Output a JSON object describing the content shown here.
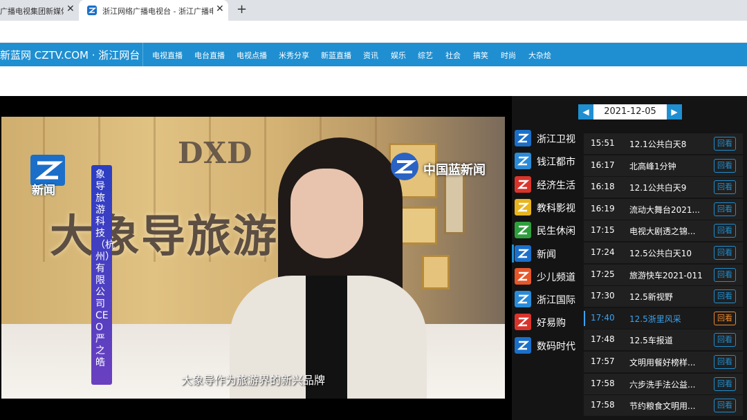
{
  "browser": {
    "tabs": [
      {
        "title": "广播电视集团新媒体",
        "close": "✕"
      },
      {
        "title": "浙江网络广播电视台 - 浙江广播电视",
        "close": "✕"
      }
    ],
    "new_tab": "+"
  },
  "site": {
    "title": "新蓝网 CZTV.COM · 浙江网台",
    "nav": [
      "电视直播",
      "电台直播",
      "电视点播",
      "米秀分享",
      "新蓝直播",
      "资讯",
      "娱乐",
      "综艺",
      "社会",
      "搞笑",
      "时尚",
      "大杂烩"
    ]
  },
  "video": {
    "wall_logo": "DXD",
    "wall_text": "大象导旅游",
    "channel_logo_text": "新闻",
    "corner_logo_text": "中国蓝新闻",
    "lower_third": "象导旅游科技（杭州）有限公司 CEO 严之皓",
    "caption": "大象导作为旅游界的新兴品牌"
  },
  "epg": {
    "date": "2021-12-05",
    "prev_icon": "arrow-left-icon",
    "next_icon": "arrow-right-icon",
    "channels": [
      {
        "name": "浙江卫视",
        "color": "#1b6fc9"
      },
      {
        "name": "钱江都市",
        "color": "#2a8bd8"
      },
      {
        "name": "经济生活",
        "color": "#d9342b"
      },
      {
        "name": "教科影视",
        "color": "#e8b520"
      },
      {
        "name": "民生休闲",
        "color": "#2f9e3d"
      },
      {
        "name": "新闻",
        "color": "#1b6fc9"
      },
      {
        "name": "少儿频道",
        "color": "#e6572a"
      },
      {
        "name": "浙江国际",
        "color": "#2a8bd8"
      },
      {
        "name": "好易购",
        "color": "#d9342b"
      },
      {
        "name": "数码时代",
        "color": "#1b6fc9"
      }
    ],
    "active_channel": "新闻",
    "replay_label": "回看",
    "programs": [
      {
        "time": "15:51",
        "title": "12.1公共白天8"
      },
      {
        "time": "16:17",
        "title": "北高峰1分钟"
      },
      {
        "time": "16:18",
        "title": "12.1公共白天9"
      },
      {
        "time": "16:19",
        "title": "流动大舞台2021..."
      },
      {
        "time": "17:15",
        "title": "电视大剧透之锦..."
      },
      {
        "time": "17:24",
        "title": "12.5公共白天10"
      },
      {
        "time": "17:25",
        "title": "旅游快车2021-011"
      },
      {
        "time": "17:30",
        "title": "12.5新视野"
      },
      {
        "time": "17:40",
        "title": "12.5浙里风采"
      },
      {
        "time": "17:48",
        "title": "12.5车报道"
      },
      {
        "time": "17:57",
        "title": "文明用餐好榜样..."
      },
      {
        "time": "17:58",
        "title": "六步洗手法公益..."
      },
      {
        "time": "17:58",
        "title": "节约粮食文明用..."
      }
    ],
    "active_program": "12.5浙里风采"
  }
}
